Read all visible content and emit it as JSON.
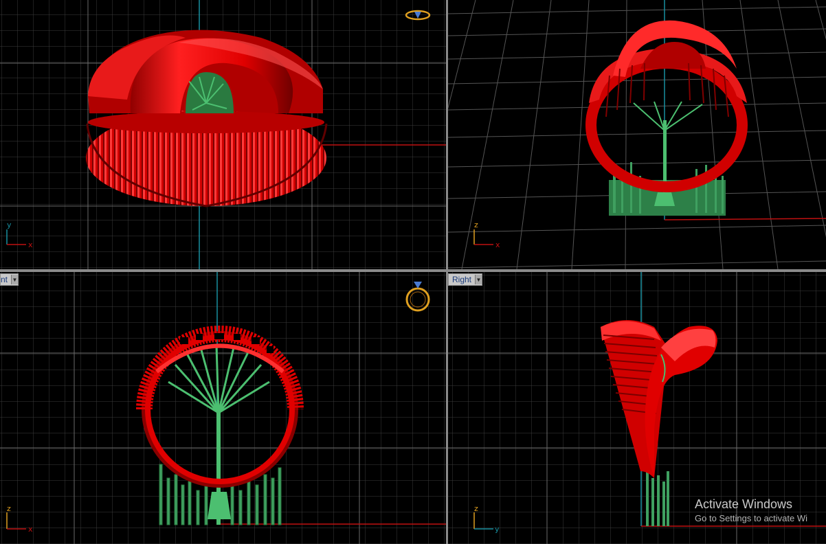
{
  "viewports": {
    "top_left": {
      "axes": {
        "x": "x",
        "y": "y"
      }
    },
    "top_right": {
      "axes": {
        "x": "x",
        "y": "z"
      }
    },
    "bottom_left": {
      "label": "nt",
      "axes": {
        "x": "x",
        "y": "z"
      }
    },
    "bottom_right": {
      "label": "Right",
      "axes": {
        "x": "y",
        "y": "z"
      }
    }
  },
  "watermark": {
    "line1": "Activate Windows",
    "line2": "Go to Settings to activate Wi"
  },
  "colors": {
    "model": "#e00000",
    "supports": "#3fa060",
    "grid": "#3c3c3c",
    "grid_major": "#6a6a6a",
    "axis_red": "#c01010",
    "axis_cyan": "#1890a0",
    "ring_icon": "#e0a020"
  }
}
